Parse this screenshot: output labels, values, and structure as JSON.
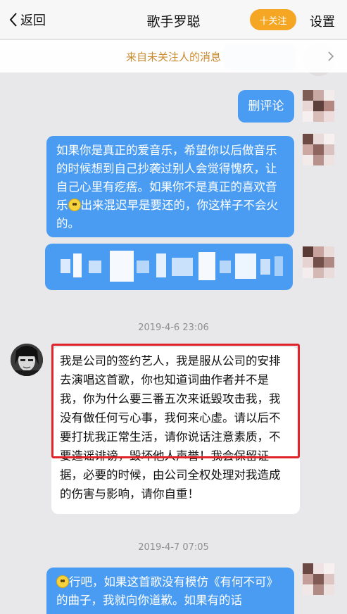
{
  "header": {
    "back_label": "返回",
    "title": "歌手罗聪",
    "follow_label": "十关注",
    "settings_label": "设置"
  },
  "notice": {
    "text": "来自未关注人的消息"
  },
  "messages": [
    {
      "side": "right",
      "text": "删评论"
    },
    {
      "side": "right",
      "text_before": "如果你是真正的爱音乐，希望你以后做音乐的时候想到自己抄袭过别人会觉得愧疚，让自己心里有疙瘩。如果你不是真正的喜欢音乐",
      "emoji": "smile",
      "text_after": "出来混迟早是要还的，你这样子不会火的。"
    },
    {
      "side": "right",
      "text": "",
      "pixelated": true
    },
    {
      "side": "left",
      "text": "我是公司的签约艺人，我是服从公司的安排去演唱这首歌，你也知道词曲作者并不是我，你为什么要三番五次来诋毁攻击我，我没有做任何亏心事，我何来心虚。请以后不要打扰我正常生活，请你说话注意素质，不要造谣诽谤，毁坏他人声誉！我会保留证据，必要的时候，由公司全权处理对我造成的伤害与影响，请你自重！"
    },
    {
      "side": "right",
      "emoji": "smile",
      "text": "行吧，如果这首歌没有模仿《有何不可》的曲子，我就向你道歉。如果有的话"
    }
  ],
  "timestamps": [
    "2019-4-6 23:06",
    "2019-4-7 07:05"
  ],
  "colors": {
    "outgoing_bubble": "#4a9cf2",
    "incoming_bubble": "#ffffff",
    "follow_button": "#f5a623",
    "notice_text": "#c98a2c",
    "highlight_border": "#e0242a"
  }
}
